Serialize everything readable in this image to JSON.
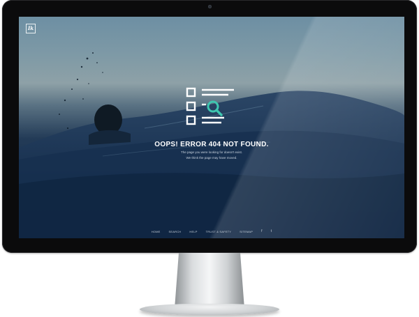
{
  "page": {
    "logo_text": "Ik",
    "error_title": "OOPS! ERROR 404 NOT FOUND.",
    "message_line1": "The page you were looking for doesn't exist.",
    "message_line2": "We think the page may have moved."
  },
  "footer": {
    "links": [
      "HOME",
      "SEARCH",
      "HELP",
      "TRUST & SAFETY",
      "SITEMAP"
    ],
    "social": {
      "facebook": "f",
      "twitter": "t"
    }
  },
  "colors": {
    "accent": "#3ec6b0",
    "text": "#ffffff",
    "bezel": "#0b0b0c"
  },
  "icons": [
    "search-list-icon",
    "facebook-icon",
    "twitter-icon",
    "camera-icon"
  ]
}
